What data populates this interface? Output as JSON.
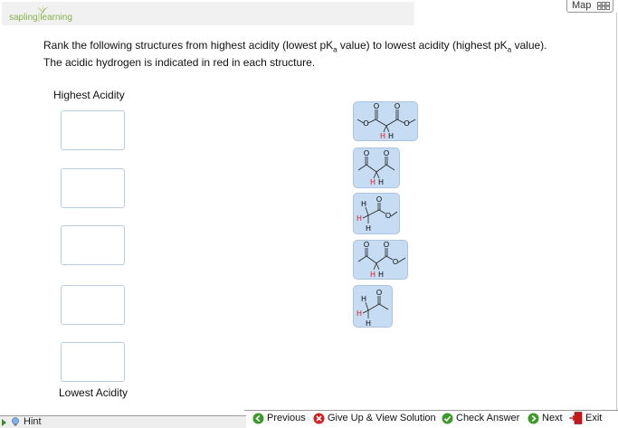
{
  "header": {
    "logo_part1": "sapling",
    "logo_part2": "learning",
    "map_label": "Map"
  },
  "question": {
    "line1_a": "Rank the following structures from highest acidity (lowest pK",
    "line1_sub": "a",
    "line1_b": " value) to lowest acidity (highest pK",
    "line1_sub2": "a",
    "line1_c": " value).",
    "line2": "The acidic hydrogen is indicated in red in each structure."
  },
  "ranking": {
    "top_label": "Highest Acidity",
    "bottom_label": "Lowest Acidity",
    "slot_count": 5
  },
  "atoms": {
    "oxygen": "O",
    "hydrogen": "H"
  },
  "footer": {
    "hint_label": "Hint",
    "previous_label": "Previous",
    "give_up_label": "Give Up & View Solution",
    "check_label": "Check Answer",
    "next_label": "Next",
    "exit_label": "Exit"
  },
  "colors": {
    "brand_green": "#8ab04a",
    "tile_bg": "#c5dcf2",
    "acidic_hydrogen": "#e0141e",
    "nav_green": "#3c9a2a",
    "give_up_red": "#d42020"
  }
}
